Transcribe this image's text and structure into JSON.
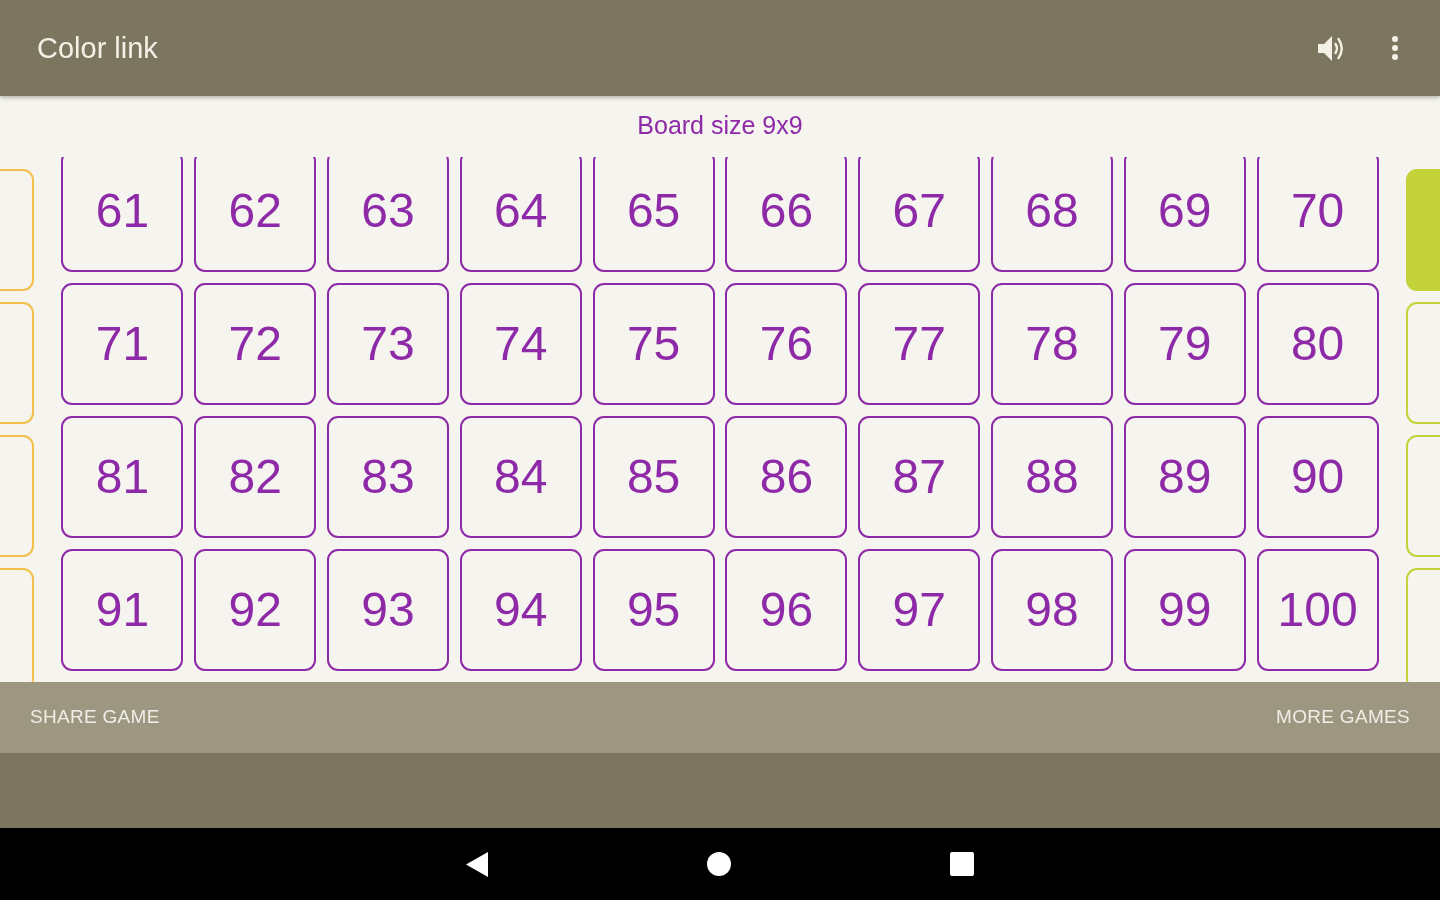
{
  "app_bar": {
    "title": "Color link"
  },
  "board_label": "Board size 9x9",
  "pages": [
    {
      "kind": "previous",
      "color": "#f2c04a",
      "tiles": [
        {
          "filled": false
        },
        {
          "filled": false
        },
        {
          "filled": false
        },
        {
          "filled": false
        }
      ]
    },
    {
      "kind": "current",
      "color": "#8e2aa8",
      "tiles": [
        {
          "label": "61",
          "filled": false
        },
        {
          "label": "62",
          "filled": false
        },
        {
          "label": "63",
          "filled": false
        },
        {
          "label": "64",
          "filled": false
        },
        {
          "label": "65",
          "filled": false
        },
        {
          "label": "66",
          "filled": false
        },
        {
          "label": "67",
          "filled": false
        },
        {
          "label": "68",
          "filled": false
        },
        {
          "label": "69",
          "filled": false
        },
        {
          "label": "70",
          "filled": false
        },
        {
          "label": "71",
          "filled": false
        },
        {
          "label": "72",
          "filled": false
        },
        {
          "label": "73",
          "filled": false
        },
        {
          "label": "74",
          "filled": false
        },
        {
          "label": "75",
          "filled": false
        },
        {
          "label": "76",
          "filled": false
        },
        {
          "label": "77",
          "filled": false
        },
        {
          "label": "78",
          "filled": false
        },
        {
          "label": "79",
          "filled": false
        },
        {
          "label": "80",
          "filled": false
        },
        {
          "label": "81",
          "filled": false
        },
        {
          "label": "82",
          "filled": false
        },
        {
          "label": "83",
          "filled": false
        },
        {
          "label": "84",
          "filled": false
        },
        {
          "label": "85",
          "filled": false
        },
        {
          "label": "86",
          "filled": false
        },
        {
          "label": "87",
          "filled": false
        },
        {
          "label": "88",
          "filled": false
        },
        {
          "label": "89",
          "filled": false
        },
        {
          "label": "90",
          "filled": false
        },
        {
          "label": "91",
          "filled": false
        },
        {
          "label": "92",
          "filled": false
        },
        {
          "label": "93",
          "filled": false
        },
        {
          "label": "94",
          "filled": false
        },
        {
          "label": "95",
          "filled": false
        },
        {
          "label": "96",
          "filled": false
        },
        {
          "label": "97",
          "filled": false
        },
        {
          "label": "98",
          "filled": false
        },
        {
          "label": "99",
          "filled": false
        },
        {
          "label": "100",
          "filled": false
        }
      ]
    },
    {
      "kind": "next",
      "color": "#c4d23a",
      "tiles": [
        {
          "filled": true
        },
        {
          "filled": false
        },
        {
          "filled": false
        },
        {
          "filled": false
        }
      ]
    }
  ],
  "bottom_bar": {
    "buttons": [
      {
        "label": "SHARE GAME"
      },
      {
        "label": "MORE GAMES"
      }
    ]
  }
}
